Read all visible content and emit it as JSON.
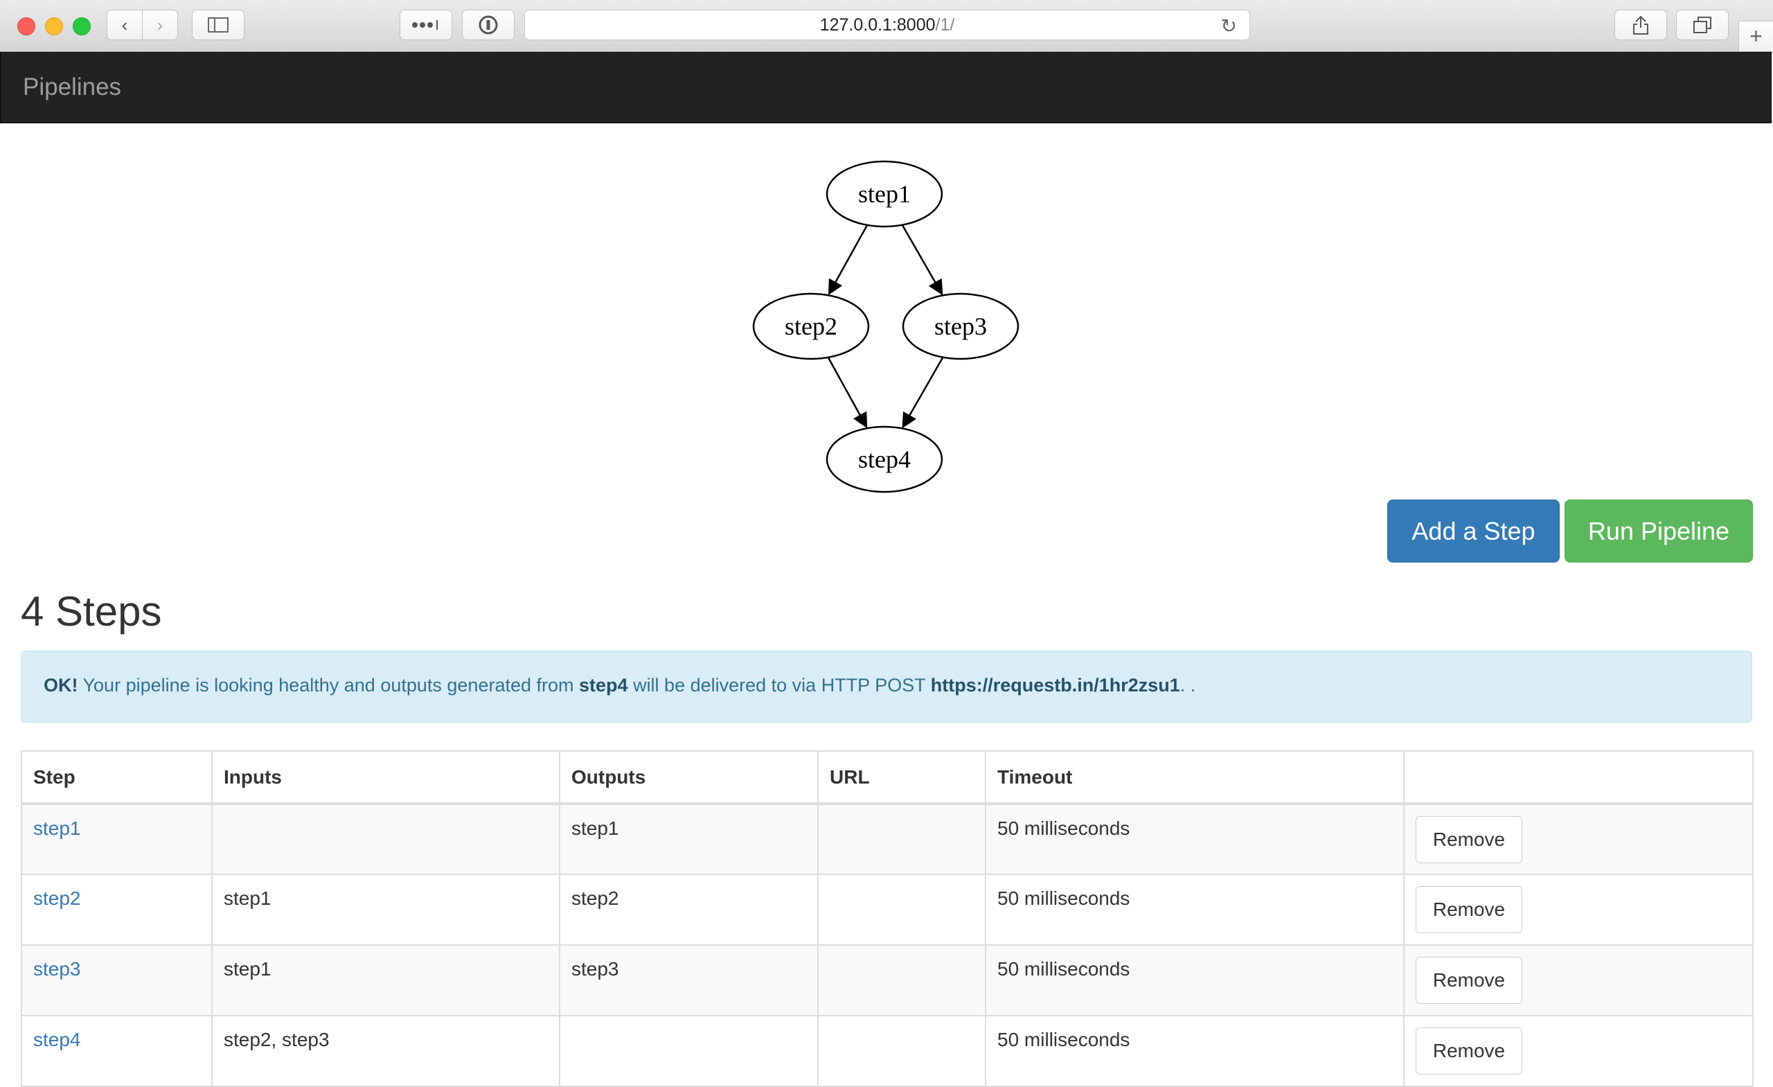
{
  "browser": {
    "url_host": "127.0.0.1:8000",
    "url_path": "/1/"
  },
  "navbar": {
    "brand": "Pipelines"
  },
  "graph": {
    "nodes": [
      {
        "id": "step1",
        "label": "step1"
      },
      {
        "id": "step2",
        "label": "step2"
      },
      {
        "id": "step3",
        "label": "step3"
      },
      {
        "id": "step4",
        "label": "step4"
      }
    ],
    "edges": [
      {
        "from": "step1",
        "to": "step2"
      },
      {
        "from": "step1",
        "to": "step3"
      },
      {
        "from": "step2",
        "to": "step4"
      },
      {
        "from": "step3",
        "to": "step4"
      }
    ]
  },
  "actions": {
    "add_step": "Add a Step",
    "run_pipeline": "Run Pipeline"
  },
  "heading": "4 Steps",
  "alert": {
    "strong": "OK!",
    "text1": " Your pipeline is looking healthy and outputs generated from ",
    "step": "step4",
    "text2": " will be delivered to via HTTP POST ",
    "url": "https://requestb.in/1hr2zsu1",
    "text3": ". ."
  },
  "table": {
    "headers": [
      "Step",
      "Inputs",
      "Outputs",
      "URL",
      "Timeout",
      ""
    ],
    "rows": [
      {
        "step": "step1",
        "inputs": "",
        "outputs": "step1",
        "url": "",
        "timeout": "50 milliseconds",
        "action": "Remove"
      },
      {
        "step": "step2",
        "inputs": "step1",
        "outputs": "step2",
        "url": "",
        "timeout": "50 milliseconds",
        "action": "Remove"
      },
      {
        "step": "step3",
        "inputs": "step1",
        "outputs": "step3",
        "url": "",
        "timeout": "50 milliseconds",
        "action": "Remove"
      },
      {
        "step": "step4",
        "inputs": "step2, step3",
        "outputs": "",
        "url": "",
        "timeout": "50 milliseconds",
        "action": "Remove"
      }
    ]
  },
  "colors": {
    "primary": "#337ab7",
    "success": "#5cb85c",
    "info_bg": "#d9edf7",
    "navbar_bg": "#222222"
  }
}
